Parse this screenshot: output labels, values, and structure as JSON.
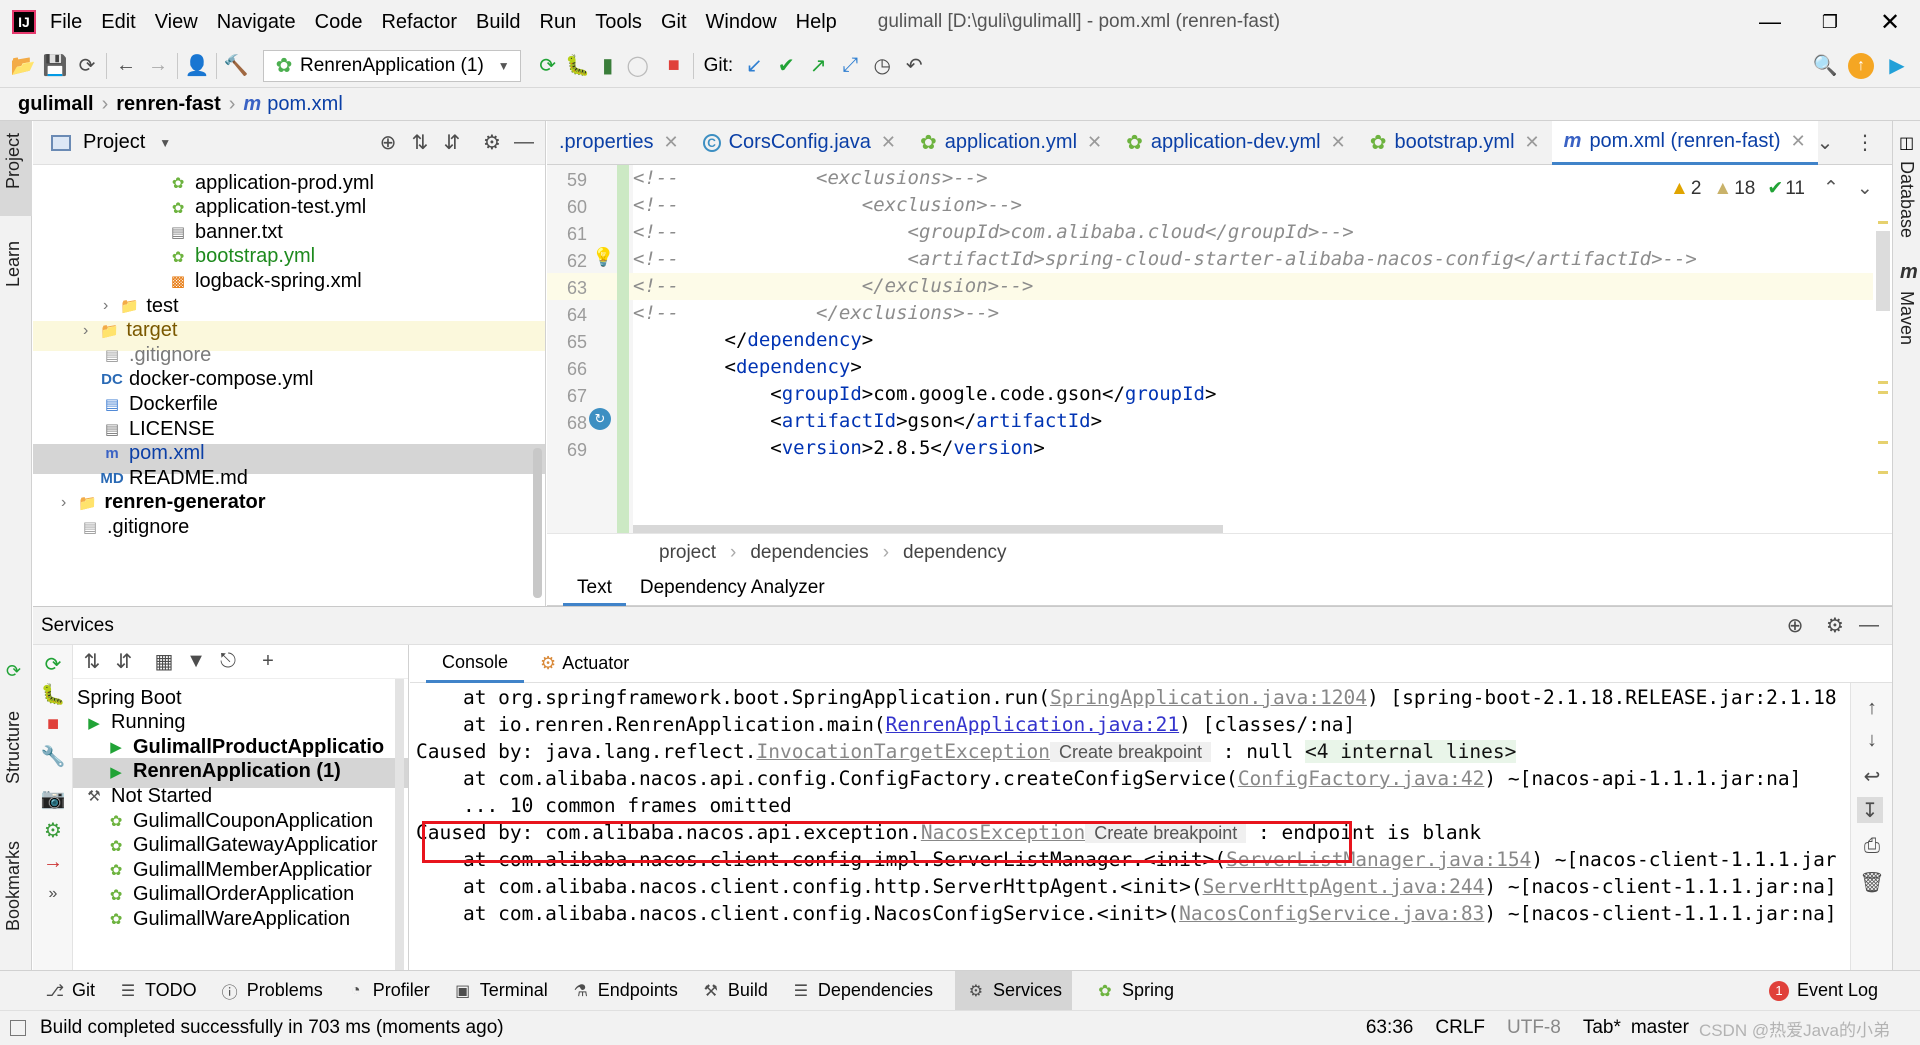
{
  "window": {
    "menus": [
      "File",
      "Edit",
      "View",
      "Navigate",
      "Code",
      "Refactor",
      "Build",
      "Run",
      "Tools",
      "Git",
      "Window",
      "Help"
    ],
    "title": "gulimall [D:\\guli\\gulimall] - pom.xml (renren-fast)"
  },
  "toolbar": {
    "run_config": "RenrenApplication (1)",
    "git_label": "Git:"
  },
  "breadcrumb": [
    "gulimall",
    "renren-fast",
    "pom.xml"
  ],
  "left_stripe": {
    "project": "Project",
    "learn": "Learn",
    "structure": "Structure",
    "bookmarks": "Bookmarks"
  },
  "right_stripe": {
    "database": "Database",
    "maven": "Maven"
  },
  "project_panel": {
    "title": "Project",
    "items": [
      {
        "label": "application-prod.yml",
        "kind": "yml",
        "color": "#000000"
      },
      {
        "label": "application-test.yml",
        "kind": "yml",
        "color": "#000000"
      },
      {
        "label": "banner.txt",
        "kind": "txt",
        "color": "#000000"
      },
      {
        "label": "bootstrap.yml",
        "kind": "yml",
        "color": "#1d8a1d"
      },
      {
        "label": "logback-spring.xml",
        "kind": "xml",
        "color": "#000000"
      },
      {
        "label": "test",
        "kind": "folder",
        "color": "#000000"
      },
      {
        "label": "target",
        "kind": "folder-orange",
        "color": "#7a5800"
      },
      {
        "label": ".gitignore",
        "kind": "git",
        "color": "#7a7a7a"
      },
      {
        "label": "docker-compose.yml",
        "kind": "dc",
        "color": "#000000"
      },
      {
        "label": "Dockerfile",
        "kind": "docker",
        "color": "#000000"
      },
      {
        "label": "LICENSE",
        "kind": "txt",
        "color": "#000000"
      },
      {
        "label": "pom.xml",
        "kind": "maven",
        "color": "#0b3fa6"
      },
      {
        "label": "README.md",
        "kind": "md",
        "color": "#000000"
      },
      {
        "label": "renren-generator",
        "kind": "module",
        "color": "#000000"
      },
      {
        "label": ".gitignore",
        "kind": "git",
        "color": "#000000"
      }
    ]
  },
  "editor": {
    "tabs": [
      {
        "label": ".properties",
        "icon": "props"
      },
      {
        "label": "CorsConfig.java",
        "icon": "class"
      },
      {
        "label": "application.yml",
        "icon": "yml"
      },
      {
        "label": "application-dev.yml",
        "icon": "yml"
      },
      {
        "label": "bootstrap.yml",
        "icon": "yml"
      },
      {
        "label": "pom.xml (renren-fast)",
        "icon": "maven"
      }
    ],
    "inspections": {
      "warnings": "2",
      "weak_warnings": "18",
      "typos": "11"
    },
    "line_numbers": [
      "59",
      "60",
      "61",
      "62",
      "63",
      "64",
      "65",
      "66",
      "67",
      "68",
      "69"
    ],
    "lines": [
      {
        "indent": "              ",
        "parts": [
          {
            "t": "<!--",
            "c": "cmt"
          },
          {
            "t": "            <exclusions>-->",
            "c": "cmt"
          }
        ]
      },
      {
        "indent": "",
        "parts": [
          {
            "t": "<!--",
            "c": "cmt"
          },
          {
            "t": "                <exclusion>-->",
            "c": "cmt"
          }
        ]
      },
      {
        "indent": "",
        "parts": [
          {
            "t": "<!--",
            "c": "cmt"
          },
          {
            "t": "                    <groupId>com.alibaba.cloud</groupId>-->",
            "c": "cmt"
          }
        ]
      },
      {
        "indent": "",
        "parts": [
          {
            "t": "<!--",
            "c": "cmt"
          },
          {
            "t": "                    <artifactId>spring-cloud-starter-alibaba-nacos-config</artifactId>-->",
            "c": "cmt"
          }
        ]
      },
      {
        "indent": "",
        "parts": [
          {
            "t": "<!--",
            "c": "cmt"
          },
          {
            "t": "                </exclusion>-->",
            "c": "cmt"
          }
        ]
      },
      {
        "indent": "",
        "parts": [
          {
            "t": "<!--",
            "c": "cmt"
          },
          {
            "t": "            </exclusions>-->",
            "c": "cmt"
          }
        ]
      },
      {
        "indent": "",
        "parts": [
          {
            "t": "        </",
            "c": "txt"
          },
          {
            "t": "dependency",
            "c": "tag"
          },
          {
            "t": ">",
            "c": "txt"
          }
        ]
      },
      {
        "indent": "",
        "parts": [
          {
            "t": "        <",
            "c": "txt"
          },
          {
            "t": "dependency",
            "c": "tag"
          },
          {
            "t": ">",
            "c": "txt"
          }
        ]
      },
      {
        "indent": "",
        "parts": [
          {
            "t": "            <",
            "c": "txt"
          },
          {
            "t": "groupId",
            "c": "tag"
          },
          {
            "t": ">com.google.code.gson</",
            "c": "txt"
          },
          {
            "t": "groupId",
            "c": "tag"
          },
          {
            "t": ">",
            "c": "txt"
          }
        ]
      },
      {
        "indent": "",
        "parts": [
          {
            "t": "            <",
            "c": "txt"
          },
          {
            "t": "artifactId",
            "c": "tag"
          },
          {
            "t": ">gson</",
            "c": "txt"
          },
          {
            "t": "artifactId",
            "c": "tag"
          },
          {
            "t": ">",
            "c": "txt"
          }
        ]
      },
      {
        "indent": "",
        "parts": [
          {
            "t": "            <",
            "c": "txt"
          },
          {
            "t": "version",
            "c": "tag"
          },
          {
            "t": ">2.8.5</",
            "c": "txt"
          },
          {
            "t": "version",
            "c": "tag"
          },
          {
            "t": ">",
            "c": "txt"
          }
        ]
      }
    ],
    "crumbs": [
      "project",
      "dependencies",
      "dependency"
    ],
    "bottom_tabs": [
      "Text",
      "Dependency Analyzer"
    ]
  },
  "services": {
    "title": "Services",
    "tree": [
      {
        "label": "Spring Boot",
        "level": 0
      },
      {
        "label": "Running",
        "level": 1
      },
      {
        "label": "GulimallProductApplicatio",
        "level": 2
      },
      {
        "label": "RenrenApplication (1)",
        "level": 2
      },
      {
        "label": "Not Started",
        "level": 1
      },
      {
        "label": "GulimallCouponApplication",
        "level": 2
      },
      {
        "label": "GulimallGatewayApplicatior",
        "level": 2
      },
      {
        "label": "GulimallMemberApplicatior",
        "level": 2
      },
      {
        "label": "GulimallOrderApplication",
        "level": 2
      },
      {
        "label": "GulimallWareApplication",
        "level": 2
      }
    ],
    "console_tabs": [
      "Console",
      "Actuator"
    ],
    "console_lines": [
      {
        "parts": [
          {
            "t": "    at org.springframework.boot.SpringApplication.run(",
            "c": "txt"
          },
          {
            "t": "SpringApplication.java:1204",
            "c": "glink"
          },
          {
            "t": ") [spring-boot-2.1.18.RELEASE.jar:2.1.18",
            "c": "txt"
          }
        ]
      },
      {
        "parts": [
          {
            "t": "    at io.renren.RenrenApplication.main(",
            "c": "txt"
          },
          {
            "t": "RenrenApplication.java:21",
            "c": "link"
          },
          {
            "t": ") [classes/:na]",
            "c": "txt"
          }
        ]
      },
      {
        "parts": [
          {
            "t": "Caused by: java.lang.reflect.",
            "c": "txt"
          },
          {
            "t": "InvocationTargetException",
            "c": "glink"
          },
          {
            "t": " Create breakpoint ",
            "c": "hint"
          },
          {
            "t": " : null ",
            "c": "txt"
          },
          {
            "t": "<4 internal lines>",
            "c": "internal"
          }
        ]
      },
      {
        "parts": [
          {
            "t": "    at com.alibaba.nacos.api.config.ConfigFactory.createConfigService(",
            "c": "txt"
          },
          {
            "t": "ConfigFactory.java:42",
            "c": "glink"
          },
          {
            "t": ") ~[nacos-api-1.1.1.jar:na]",
            "c": "txt"
          }
        ]
      },
      {
        "parts": [
          {
            "t": "    ... 10 common frames omitted",
            "c": "txt"
          }
        ]
      },
      {
        "parts": [
          {
            "t": "Caused by: com.alibaba.nacos.api.exception.",
            "c": "txt"
          },
          {
            "t": "NacosException",
            "c": "glink"
          },
          {
            "t": " Create breakpoint ",
            "c": "hint"
          },
          {
            "t": " : endpoint is blank",
            "c": "txt"
          }
        ]
      },
      {
        "parts": [
          {
            "t": "    at com.alibaba.nacos.client.config.impl.ServerListManager.<init>(",
            "c": "txt"
          },
          {
            "t": "ServerListManager.java:154",
            "c": "glink"
          },
          {
            "t": ") ~[nacos-client-1.1.1.jar",
            "c": "txt"
          }
        ]
      },
      {
        "parts": [
          {
            "t": "    at com.alibaba.nacos.client.config.http.ServerHttpAgent.<init>(",
            "c": "txt"
          },
          {
            "t": "ServerHttpAgent.java:244",
            "c": "glink"
          },
          {
            "t": ") ~[nacos-client-1.1.1.jar:na]",
            "c": "txt"
          }
        ]
      },
      {
        "parts": [
          {
            "t": "    at com.alibaba.nacos.client.config.NacosConfigService.<init>(",
            "c": "txt"
          },
          {
            "t": "NacosConfigService.java:83",
            "c": "glink"
          },
          {
            "t": ") ~[nacos-client-1.1.1.jar:na]",
            "c": "txt"
          }
        ]
      }
    ]
  },
  "tool_windows": [
    "Git",
    "TODO",
    "Problems",
    "Profiler",
    "Terminal",
    "Endpoints",
    "Build",
    "Dependencies",
    "Services",
    "Spring"
  ],
  "event_log": {
    "label": "Event Log",
    "count": "1"
  },
  "status": {
    "message": "Build completed successfully in 703 ms (moments ago)",
    "position": "63:36",
    "line_sep": "CRLF",
    "encoding": "UTF-8",
    "indent": "Tab*",
    "branch": "master",
    "watermark": "CSDN @热爱Java的小弟"
  },
  "colors": {
    "highlight_box": "#e8141d",
    "run_green": "#21a336",
    "selected_tab_underline": "#4083c9"
  }
}
